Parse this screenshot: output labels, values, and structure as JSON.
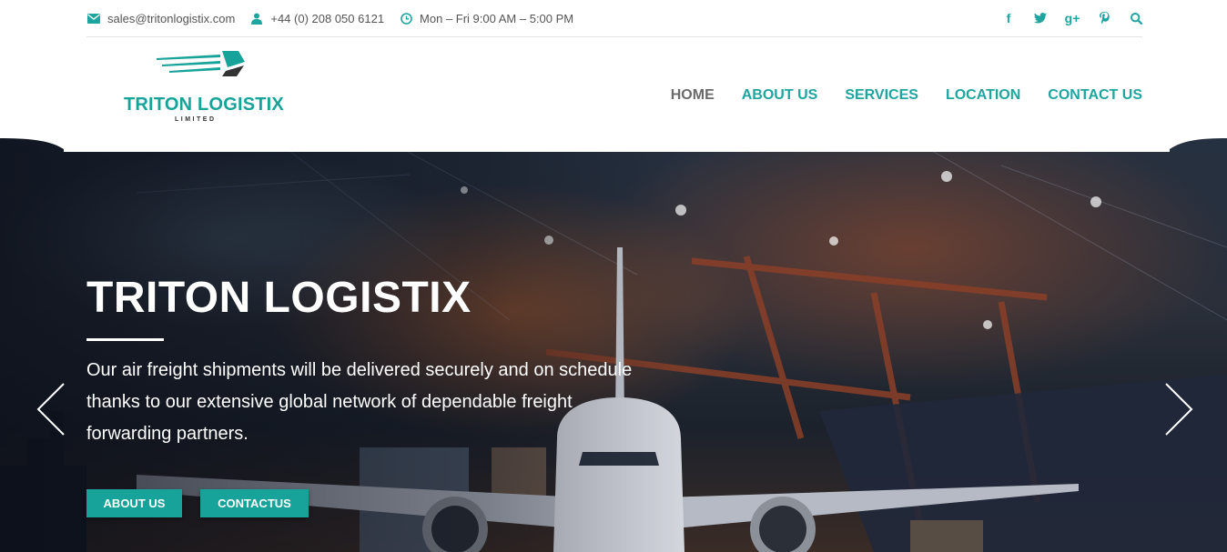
{
  "topbar": {
    "email": "sales@tritonlogistix.com",
    "phone": "+44 (0) 208 050 6121",
    "hours": "Mon – Fri 9:00 AM – 5:00 PM",
    "icons": [
      "envelope-icon",
      "user-icon",
      "clock-icon"
    ],
    "socials": [
      "facebook-icon",
      "twitter-icon",
      "google-plus-icon",
      "pinterest-icon",
      "search-icon"
    ]
  },
  "logo": {
    "name": "TRITON LOGISTIX",
    "sub": "LIMITED"
  },
  "nav": {
    "items": [
      {
        "label": "HOME",
        "active": true
      },
      {
        "label": "ABOUT US"
      },
      {
        "label": "SERVICES"
      },
      {
        "label": "LOCATION"
      },
      {
        "label": "CONTACT US"
      }
    ]
  },
  "hero": {
    "title": "TRITON LOGISTIX",
    "description": "Our air freight shipments will be delivered securely and on schedule thanks to our extensive global network of dependable freight forwarding partners.",
    "btn_about": "ABOUT US",
    "btn_contact": "CONTACTUS"
  },
  "colors": {
    "accent": "#17a39a",
    "nav_active": "#6a6a6a",
    "topbar_text": "#555555"
  }
}
